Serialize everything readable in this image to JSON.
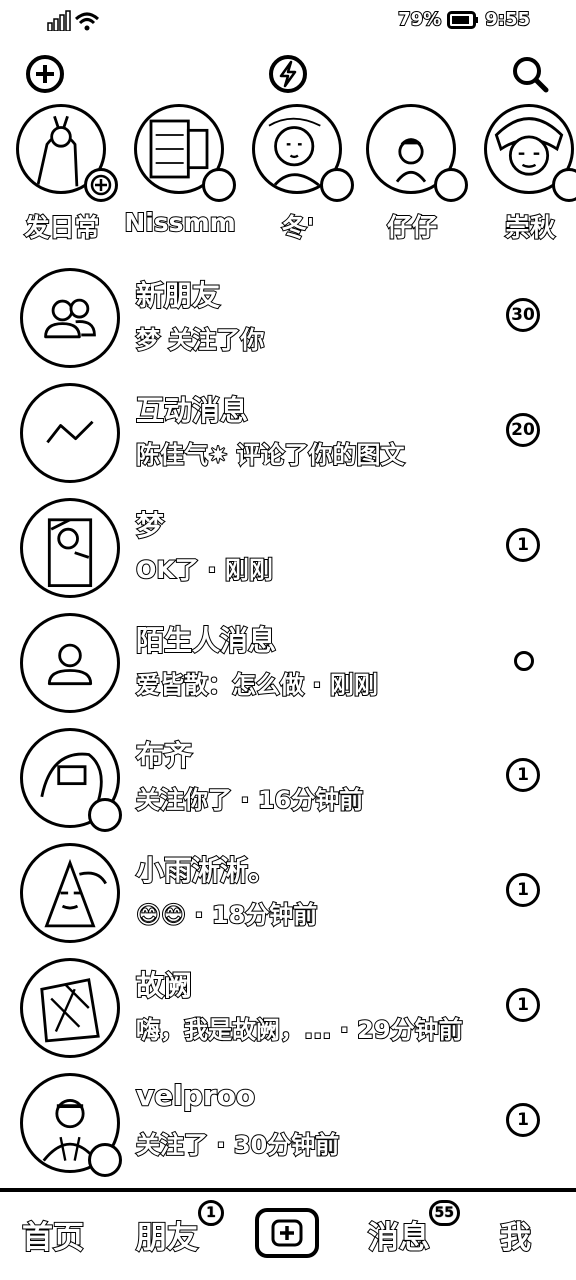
{
  "status_bar": {
    "battery": "79%",
    "time": "9:55"
  },
  "top_actions": {
    "add_icon": "plus-circle-icon",
    "flash_icon": "lightning-icon",
    "search_icon": "search-icon"
  },
  "stories": [
    {
      "name": "发日常",
      "badge": "plus"
    },
    {
      "name": "Nissmm",
      "badge": "dot"
    },
    {
      "name": "冬'",
      "badge": "dot"
    },
    {
      "name": "仔仔",
      "badge": "dot"
    },
    {
      "name": "崇秋",
      "badge": "dot"
    }
  ],
  "messages": [
    {
      "title": "新朋友",
      "subtitle": "梦 关注了你",
      "badge": "30",
      "avatar": "friends-icon"
    },
    {
      "title": "互动消息",
      "subtitle": "陈佳气✷ 评论了你的图文",
      "badge": "20",
      "avatar": "interaction-icon"
    },
    {
      "title": "梦",
      "subtitle": "OK了 · 刚刚",
      "badge": "1",
      "avatar": "photo"
    },
    {
      "title": "陌生人消息",
      "subtitle": "爱皆散：怎么做 · 刚刚",
      "badge": "",
      "avatar": "stranger-icon"
    },
    {
      "title": "布齐",
      "subtitle": "关注你了 · 16分钟前",
      "badge": "1",
      "avatar": "photo"
    },
    {
      "title": "小雨淅淅。",
      "subtitle": "😊😊 · 18分钟前",
      "badge": "1",
      "avatar": "photo"
    },
    {
      "title": "故阙",
      "subtitle": "嗨，我是故阙，... · 29分钟前",
      "badge": "1",
      "avatar": "photo"
    },
    {
      "title": "velproo",
      "subtitle": "关注了 · 30分钟前",
      "badge": "1",
      "avatar": "photo"
    }
  ],
  "bottom_nav": {
    "home": "首页",
    "friends": "朋友",
    "friends_count": "1",
    "messages": "消息",
    "messages_count": "55",
    "me": "我"
  }
}
